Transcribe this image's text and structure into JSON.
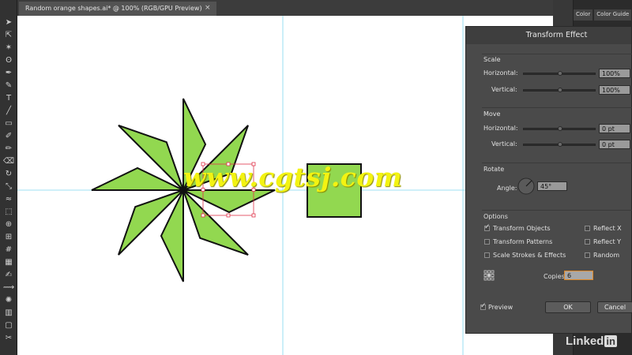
{
  "document": {
    "tab_title": "Random orange shapes.ai* @ 100% (RGB/GPU Preview)",
    "close_glyph": "×"
  },
  "panels": {
    "tabs": [
      "Color",
      "Color Guide"
    ]
  },
  "dialog": {
    "title": "Transform Effect",
    "scale": {
      "label": "Scale",
      "horizontal_label": "Horizontal:",
      "horizontal_value": "100%",
      "horizontal_level": 0.5,
      "vertical_label": "Vertical:",
      "vertical_value": "100%",
      "vertical_level": 0.5
    },
    "move": {
      "label": "Move",
      "horizontal_label": "Horizontal:",
      "horizontal_value": "0 pt",
      "horizontal_level": 0.5,
      "vertical_label": "Vertical:",
      "vertical_value": "0 pt",
      "vertical_level": 0.5
    },
    "rotate": {
      "label": "Rotate",
      "angle_label": "Angle:",
      "angle_value": "45°"
    },
    "options": {
      "label": "Options",
      "transform_objects": {
        "label": "Transform Objects",
        "checked": true
      },
      "transform_patterns": {
        "label": "Transform Patterns",
        "checked": false
      },
      "scale_strokes": {
        "label": "Scale Strokes & Effects",
        "checked": false
      },
      "reflect_x": {
        "label": "Reflect X",
        "checked": false
      },
      "reflect_y": {
        "label": "Reflect Y",
        "checked": false
      },
      "random": {
        "label": "Random",
        "checked": false
      }
    },
    "copies_label": "Copies",
    "copies_value": "6",
    "preview": {
      "label": "Preview",
      "checked": true
    },
    "ok_label": "OK",
    "cancel_label": "Cancel"
  },
  "watermark": "www.cgtsj.com",
  "brand": {
    "text": "Linked",
    "in": "in"
  },
  "colors": {
    "shape_fill": "#92d850",
    "shape_stroke": "#111111",
    "guide": "#7fd7ef",
    "selection": "#e0334a",
    "canvas": "#ffffff"
  },
  "tools": [
    "selection-tool",
    "direct-selection-tool",
    "magic-wand-tool",
    "lasso-tool",
    "pen-tool",
    "curvature-tool",
    "type-tool",
    "line-tool",
    "rectangle-tool",
    "paintbrush-tool",
    "blob-brush-tool",
    "eraser-tool",
    "rotate-tool",
    "scale-tool",
    "width-tool",
    "free-transform-tool",
    "shape-builder-tool",
    "perspective-grid-tool",
    "mesh-tool",
    "gradient-tool",
    "eyedropper-tool",
    "blend-tool",
    "symbol-sprayer-tool",
    "column-graph-tool",
    "artboard-tool",
    "slice-tool"
  ]
}
